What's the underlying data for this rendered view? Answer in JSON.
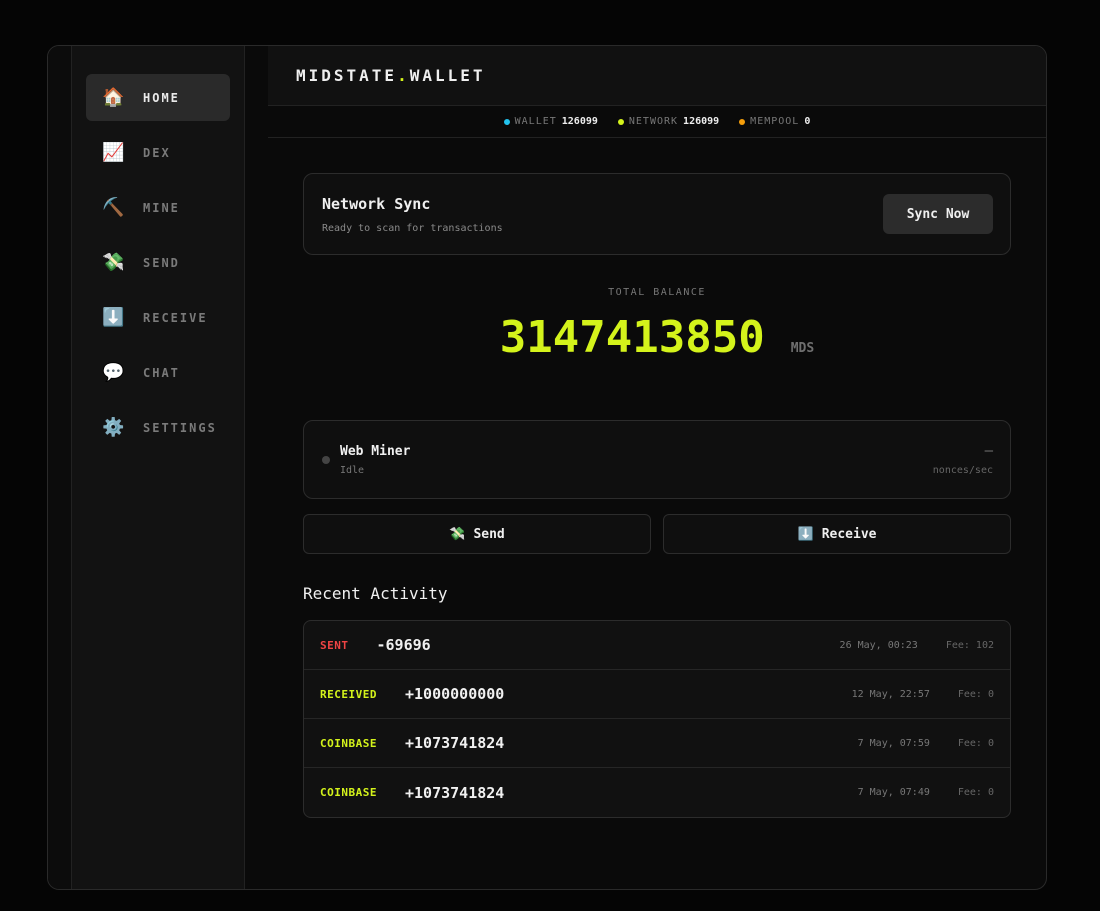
{
  "sidebar": {
    "items": [
      {
        "icon": "home-icon",
        "glyph": "🏠",
        "label": "HOME",
        "active": true
      },
      {
        "icon": "chart-icon",
        "glyph": "📈",
        "label": "DEX"
      },
      {
        "icon": "pick-icon",
        "glyph": "⛏️",
        "label": "MINE"
      },
      {
        "icon": "money-icon",
        "glyph": "💸",
        "label": "SEND"
      },
      {
        "icon": "down-arrow-icon",
        "glyph": "⬇️",
        "label": "RECEIVE"
      },
      {
        "icon": "chat-icon",
        "glyph": "💬",
        "label": "CHAT"
      },
      {
        "icon": "gear-icon",
        "glyph": "⚙️",
        "label": "SETTINGS"
      }
    ]
  },
  "header": {
    "brand_left": "MIDSTATE",
    "brand_dot": ".",
    "brand_right": "WALLET"
  },
  "status": {
    "wallet_label": "WALLET",
    "wallet_value": "126099",
    "wallet_color": "#22c3ee",
    "network_label": "NETWORK",
    "network_value": "126099",
    "network_color": "#d4f31b",
    "mempool_label": "MEMPOOL",
    "mempool_value": "0",
    "mempool_color": "#f59e0b"
  },
  "sync": {
    "title": "Network Sync",
    "subtitle": "Ready to scan for transactions",
    "button": "Sync Now"
  },
  "balance": {
    "label": "TOTAL BALANCE",
    "amount": "3147413850",
    "unit": "MDS"
  },
  "miner": {
    "title": "Web Miner",
    "status": "Idle",
    "rate": "—",
    "rate_unit": "nonces/sec"
  },
  "actions": {
    "send_glyph": "💸",
    "send_label": "Send",
    "receive_glyph": "⬇️",
    "receive_label": "Receive"
  },
  "activity": {
    "title": "Recent Activity",
    "rows": [
      {
        "type": "SENT",
        "type_color": "#ef4444",
        "amount": "-69696",
        "date": "26 May, 00:23",
        "fee": "Fee: 102"
      },
      {
        "type": "RECEIVED",
        "type_color": "#d4f31b",
        "amount": "+1000000000",
        "date": "12 May, 22:57",
        "fee": "Fee: 0"
      },
      {
        "type": "COINBASE",
        "type_color": "#d4f31b",
        "amount": "+1073741824",
        "date": "7 May, 07:59",
        "fee": "Fee: 0"
      },
      {
        "type": "COINBASE",
        "type_color": "#d4f31b",
        "amount": "+1073741824",
        "date": "7 May, 07:49",
        "fee": "Fee: 0"
      }
    ]
  },
  "colors": {
    "accent": "#d4f31b",
    "sent": "#ef4444"
  }
}
